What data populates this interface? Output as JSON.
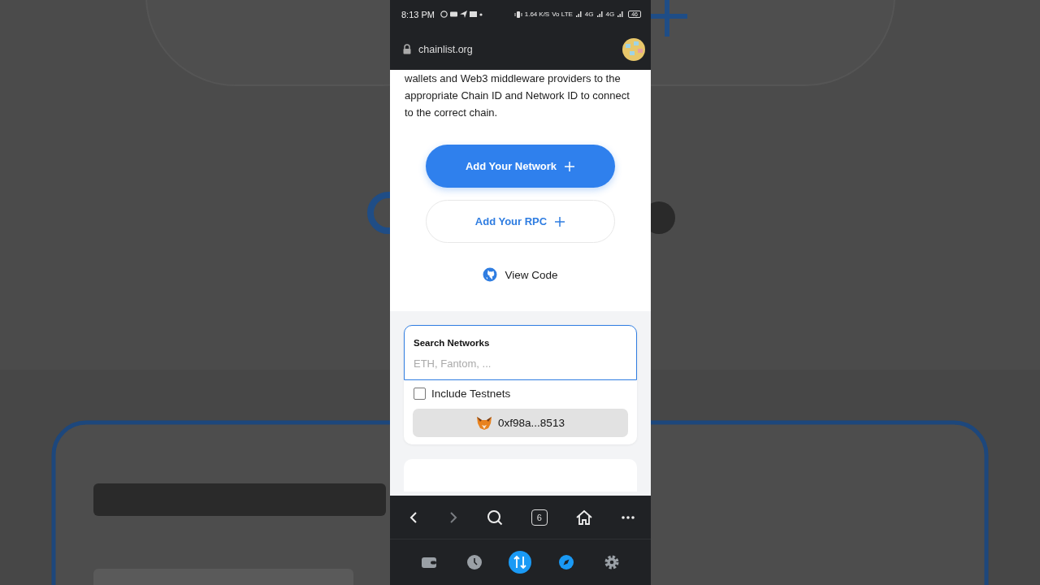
{
  "status_bar": {
    "time": "8:13 PM",
    "speed": [
      "1.64",
      "K/S"
    ],
    "network": [
      "Vo LTE",
      "4G",
      "4G"
    ],
    "battery": "46"
  },
  "address_bar": {
    "url": "chainlist.org"
  },
  "page": {
    "intro": "wallets and Web3 middleware providers to the appropriate Chain ID and Network ID to connect to the correct chain.",
    "buttons": [
      {
        "label": "Add Your Network",
        "kind": "primary"
      },
      {
        "label": "Add Your RPC",
        "kind": "outline"
      }
    ],
    "view_code": "View Code"
  },
  "search": {
    "label": "Search Networks",
    "placeholder": "ETH, Fantom, ..."
  },
  "testnets": {
    "label": "Include Testnets",
    "checked": false
  },
  "wallet": {
    "address": "0xf98a...8513"
  },
  "browser_toolbar": {
    "tabs_count": "6",
    "forward_disabled": true
  },
  "bottom_nav": [
    {
      "kind": "wallet",
      "selected": false
    },
    {
      "kind": "history",
      "selected": false
    },
    {
      "kind": "swap",
      "selected": true
    },
    {
      "kind": "explore",
      "selected": false
    },
    {
      "kind": "settings",
      "selected": false
    }
  ]
}
